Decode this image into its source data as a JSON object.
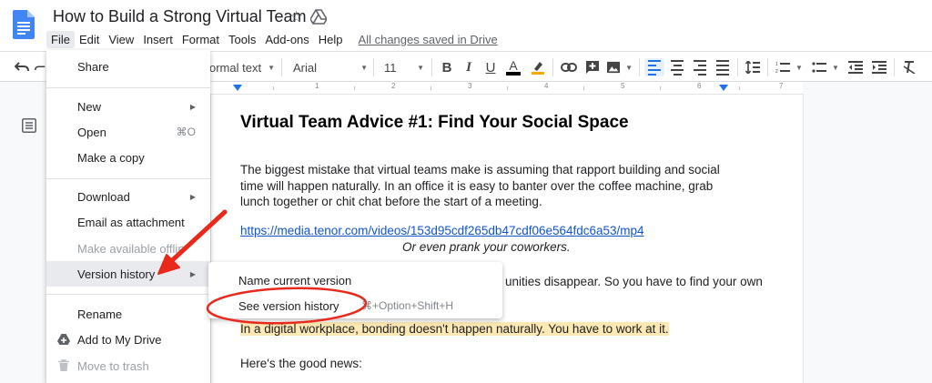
{
  "window": {
    "doc_title": "How to Build a Strong Virtual Team",
    "star_icon": "star-outline-icon",
    "drive_status_icon": "drive-icon"
  },
  "menubar": {
    "items": [
      "File",
      "Edit",
      "View",
      "Insert",
      "Format",
      "Tools",
      "Add-ons",
      "Help"
    ],
    "active": "File",
    "save_status": "All changes saved in Drive"
  },
  "toolbar": {
    "style_value": "ormal text",
    "font_value": "Arial",
    "size_value": "11",
    "text_color": "#000000",
    "highlight_color": "#f9ab00",
    "active_color": "#1a73e8"
  },
  "ruler": {
    "labels": [
      "1",
      "2",
      "3",
      "4",
      "5",
      "6",
      "7"
    ]
  },
  "document": {
    "heading": "Virtual Team Advice #1: Find Your Social Space",
    "para1": [
      "The biggest mistake that virtual teams make is assuming that rapport building and social",
      "time will happen naturally. In an office it is easy to banter over the coffee machine, grab",
      "lunch together or chit chat before the start of a meeting."
    ],
    "link": "https://media.tenor.com/videos/153d95cdf265db47cdf06e564fdc6a53/mp4",
    "caption": "Or even prank your coworkers.",
    "para2_fragment": "unities disappear. So you have to find your own",
    "highlighted": "In a digital workplace, bonding doesn't happen naturally. You have to work at it.",
    "highlight_color": "#fce8b2",
    "para3": "Here's the good news:"
  },
  "file_menu": {
    "share": "Share",
    "new": "New",
    "open": "Open",
    "open_shortcut": "⌘O",
    "make_copy": "Make a copy",
    "download": "Download",
    "email_attachment": "Email as attachment",
    "make_available_offline": "Make available offlin",
    "version_history": "Version history",
    "rename": "Rename",
    "add_to_drive": "Add to My Drive",
    "move_to_trash": "Move to trash"
  },
  "version_submenu": {
    "name_current": "Name current version",
    "see_history": "See version history",
    "see_history_shortcut": "⌘+Option+Shift+H"
  },
  "annotation": {
    "color": "#e8291c"
  }
}
